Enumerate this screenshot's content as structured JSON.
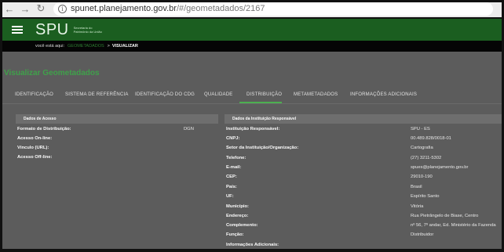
{
  "browser": {
    "url_host": "spunet.planejamento.gov.br",
    "url_path": "/#/geometadados/2167"
  },
  "header": {
    "logo": "SPU",
    "logo_sub": "Secretaria do Patrimônio da União"
  },
  "breadcrumb": {
    "prefix": "você está aqui:",
    "link": "GEOMETADADOS",
    "sep": ">",
    "current": "VISUALIZAR"
  },
  "page": {
    "title": "Visualizar Geometadados"
  },
  "tabs": [
    {
      "label": "IDENTIFICAÇÃO"
    },
    {
      "label": "SISTEMA DE REFERÊNCIA"
    },
    {
      "label": "IDENTIFICAÇÃO DO CDG"
    },
    {
      "label": "QUALIDADE"
    },
    {
      "label": "DISTRIBUIÇÃO"
    },
    {
      "label": "METAMETADADOS"
    },
    {
      "label": "INFORMAÇÕES ADICIONAIS"
    }
  ],
  "acesso": {
    "title": "Dados de Acesso",
    "rows": [
      {
        "label": "Formato de Distribuição:",
        "value": "DGN"
      },
      {
        "label": "Acesso On-line:",
        "value": ""
      },
      {
        "label": "Vínculo (URL):",
        "value": ""
      },
      {
        "label": "Acesso Off-line:",
        "value": ""
      }
    ]
  },
  "responsavel": {
    "title": "Dados da Instituição Responsável",
    "rows": [
      {
        "label": "Instituição Responsável:",
        "value": "SPU - ES"
      },
      {
        "label": "CNPJ:",
        "value": "00.489.828/0018-01"
      },
      {
        "label": "Setor da Instituição/Organização:",
        "value": "Cartografia"
      },
      {
        "label": "Telefone:",
        "value": "(27) 3211-5302"
      },
      {
        "label": "E-mail:",
        "value": "spues@planejamento.gov.br"
      },
      {
        "label": "CEP:",
        "value": "29010-190"
      },
      {
        "label": "País:",
        "value": "Brasil"
      },
      {
        "label": "UF:",
        "value": "Espírito Santo"
      },
      {
        "label": "Município:",
        "value": "Vitória"
      },
      {
        "label": "Endereço:",
        "value": "Rua Pietrângelo de Biase, Centro"
      },
      {
        "label": "Complemento:",
        "value": "nº 56, 7º andar, Ed. Ministério da Fazenda"
      },
      {
        "label": "Função:",
        "value": "Distribuidor"
      },
      {
        "label": "Informações Adicionais:",
        "value": ""
      }
    ]
  }
}
